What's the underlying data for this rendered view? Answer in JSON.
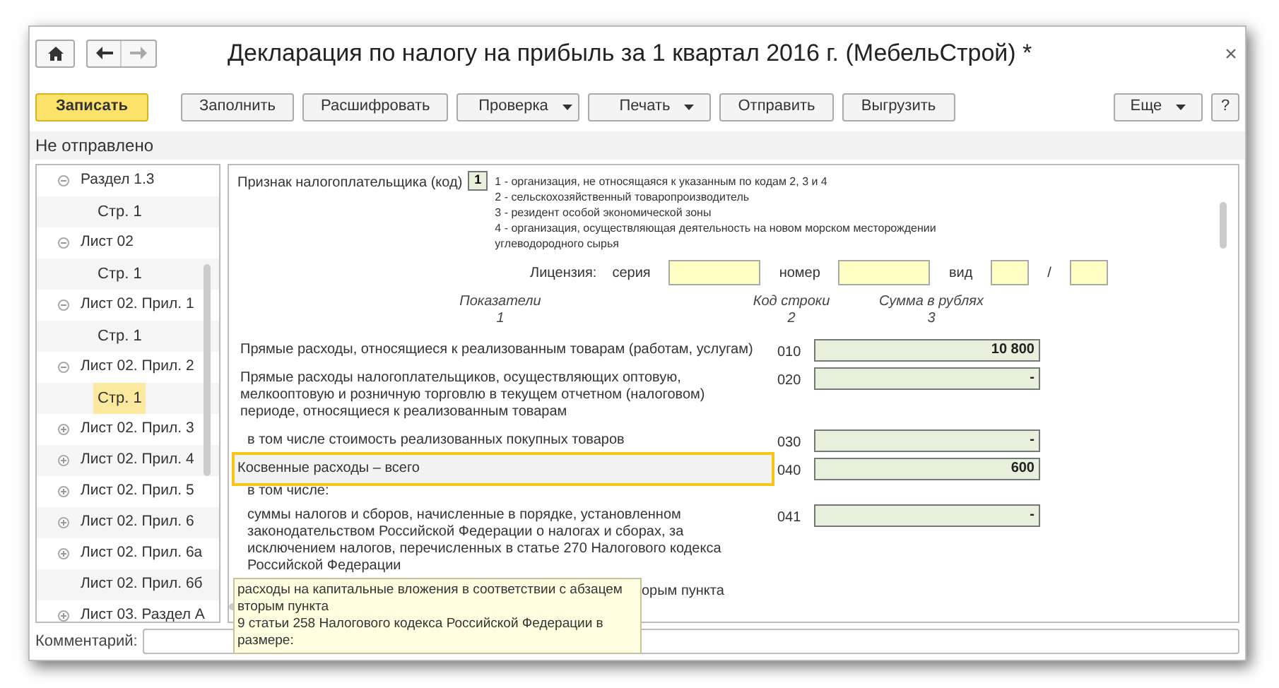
{
  "window": {
    "title": "Декларация по налогу на прибыль за 1 квартал 2016 г. (МебельСтрой) *"
  },
  "toolbar": [
    {
      "label": "Записать",
      "kind": "primary"
    },
    {
      "label": "Заполнить",
      "kind": "plain"
    },
    {
      "label": "Расшифровать",
      "kind": "plain"
    },
    {
      "label": "Проверка",
      "kind": "dropdown"
    },
    {
      "label": "Печать",
      "kind": "dropdown"
    },
    {
      "label": "Отправить",
      "kind": "plain"
    },
    {
      "label": "Выгрузить",
      "kind": "plain"
    },
    {
      "label": "Еще",
      "kind": "dropdown-right"
    },
    {
      "label": "?",
      "kind": "help"
    }
  ],
  "status": "Не отправлено",
  "tree": [
    {
      "label": "Раздел 1.3",
      "expanded": true,
      "children": [
        {
          "label": "Стр. 1",
          "selected": false
        }
      ]
    },
    {
      "label": "Лист 02",
      "expanded": true,
      "children": [
        {
          "label": "Стр. 1",
          "selected": false
        }
      ]
    },
    {
      "label": "Лист 02. Прил. 1",
      "expanded": true,
      "children": [
        {
          "label": "Стр. 1",
          "selected": false
        }
      ]
    },
    {
      "label": "Лист 02. Прил. 2",
      "expanded": true,
      "children": [
        {
          "label": "Стр. 1",
          "selected": true
        }
      ]
    },
    {
      "label": "Лист 02. Прил. 3",
      "expanded": false
    },
    {
      "label": "Лист 02. Прил. 4",
      "expanded": false
    },
    {
      "label": "Лист 02. Прил. 5",
      "expanded": false
    },
    {
      "label": "Лист 02. Прил. 6",
      "expanded": false
    },
    {
      "label": "Лист 02. Прил. 6а",
      "expanded": false
    },
    {
      "label": "Лист 02. Прил. 6б"
    },
    {
      "label": "Лист 03. Раздел А",
      "expanded": false
    }
  ],
  "form": {
    "taxpayer": {
      "label": "Признак налогоплательщика (код)",
      "code": "1",
      "options": [
        "1 - организация, не относящаяся к указанным по кодам 2, 3 и 4",
        "2 - сельскохозяйственный товаропроизводитель",
        "3 - резидент особой экономической зоны",
        "4 - организация, осуществляющая деятельность на новом морском месторождении углеводородного сырья"
      ]
    },
    "license": {
      "label": "Лицензия:",
      "parts": [
        {
          "kind": "text",
          "text": "серия"
        },
        {
          "kind": "wide-field"
        },
        {
          "kind": "text",
          "text": "номер"
        },
        {
          "kind": "wide-field"
        },
        {
          "kind": "text",
          "text": "вид"
        },
        {
          "kind": "narrow-field"
        },
        {
          "kind": "text",
          "text": "/"
        },
        {
          "kind": "narrow-field"
        }
      ]
    },
    "columns": [
      {
        "title": "Показатели",
        "number": "1"
      },
      {
        "title": "Код строки",
        "number": "2"
      },
      {
        "title": "Сумма в рублях",
        "number": "3"
      }
    ],
    "rows": [
      {
        "kind": "line",
        "label": "Прямые расходы, относящиеся к реализованным товарам (работам, услугам)",
        "code": "010",
        "value": "10 800",
        "highlighted": false
      },
      {
        "kind": "line",
        "label": "Прямые расходы налогоплательщиков, осуществляющих оптовую, мелкооптовую и розничную торговлю в текущем отчетном (налоговом) периоде, относящиеся к реализованным товарам",
        "code": "020",
        "value": "-",
        "highlighted": false
      },
      {
        "kind": "subline",
        "label": "в том числе стоимость реализованных покупных товаров",
        "code": "030",
        "value": "-",
        "highlighted": false
      },
      {
        "kind": "line",
        "label": "Косвенные расходы – всего",
        "code": "040",
        "value": "600",
        "highlighted": true
      },
      {
        "kind": "note",
        "label": "в том числе:"
      },
      {
        "kind": "subline",
        "label": "суммы налогов и сборов, начисленные в порядке, установленном законодательством Российской Федерации о налогах и сборах, за исключением налогов, перечисленных в статье 270 Налогового кодекса Российской Федерации",
        "code": "041",
        "value": "-",
        "highlighted": false
      },
      {
        "kind": "covered",
        "label": "орым пункта"
      }
    ],
    "tooltip": [
      "расходы на капитальные вложения в соответствии с абзацем вторым пункта",
      "9 статьи 258 Налогового кодекса Российской Федерации в размере:"
    ]
  },
  "comment": {
    "label": "Комментарий:"
  }
}
